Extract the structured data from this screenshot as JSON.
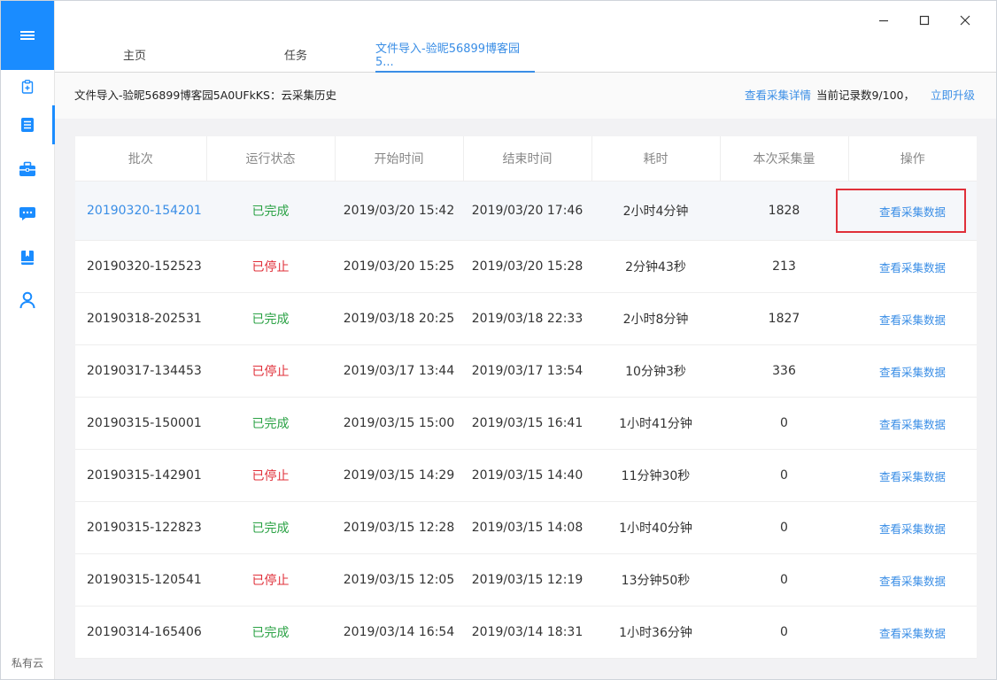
{
  "window": {
    "minimize_label": "—",
    "maximize_label": "□",
    "close_label": "×"
  },
  "sidebar": {
    "footer": "私有云",
    "items": [
      {
        "icon": "clipboard-icon"
      },
      {
        "icon": "document-icon"
      },
      {
        "icon": "briefcase-icon"
      },
      {
        "icon": "chat-icon"
      },
      {
        "icon": "bookmark-icon"
      },
      {
        "icon": "user-icon"
      }
    ]
  },
  "tabs": [
    {
      "label": "主页"
    },
    {
      "label": "任务"
    },
    {
      "label": "文件导入-验昵56899博客园5..."
    }
  ],
  "subheader": {
    "title": "文件导入-验昵56899博客园5A0UFkKS：云采集历史",
    "details_link": "查看采集详情",
    "record_count": "当前记录数9/100，",
    "upgrade_link": "立即升级"
  },
  "table": {
    "headers": [
      "批次",
      "运行状态",
      "开始时间",
      "结束时间",
      "耗时",
      "本次采集量",
      "操作"
    ],
    "rows": [
      {
        "batch": "20190320-154201",
        "status": "已完成",
        "status_type": "done",
        "start": "2019/03/20 15:42",
        "end": "2019/03/20 17:46",
        "duration": "2小时4分钟",
        "amount": "1828",
        "action": "查看采集数据"
      },
      {
        "batch": "20190320-152523",
        "status": "已停止",
        "status_type": "stop",
        "start": "2019/03/20 15:25",
        "end": "2019/03/20 15:28",
        "duration": "2分钟43秒",
        "amount": "213",
        "action": "查看采集数据"
      },
      {
        "batch": "20190318-202531",
        "status": "已完成",
        "status_type": "done",
        "start": "2019/03/18 20:25",
        "end": "2019/03/18 22:33",
        "duration": "2小时8分钟",
        "amount": "1827",
        "action": "查看采集数据"
      },
      {
        "batch": "20190317-134453",
        "status": "已停止",
        "status_type": "stop",
        "start": "2019/03/17 13:44",
        "end": "2019/03/17 13:54",
        "duration": "10分钟3秒",
        "amount": "336",
        "action": "查看采集数据"
      },
      {
        "batch": "20190315-150001",
        "status": "已完成",
        "status_type": "done",
        "start": "2019/03/15 15:00",
        "end": "2019/03/15 16:41",
        "duration": "1小时41分钟",
        "amount": "0",
        "action": "查看采集数据"
      },
      {
        "batch": "20190315-142901",
        "status": "已停止",
        "status_type": "stop",
        "start": "2019/03/15 14:29",
        "end": "2019/03/15 14:40",
        "duration": "11分钟30秒",
        "amount": "0",
        "action": "查看采集数据"
      },
      {
        "batch": "20190315-122823",
        "status": "已完成",
        "status_type": "done",
        "start": "2019/03/15 12:28",
        "end": "2019/03/15 14:08",
        "duration": "1小时40分钟",
        "amount": "0",
        "action": "查看采集数据"
      },
      {
        "batch": "20190315-120541",
        "status": "已停止",
        "status_type": "stop",
        "start": "2019/03/15 12:05",
        "end": "2019/03/15 12:19",
        "duration": "13分钟50秒",
        "amount": "0",
        "action": "查看采集数据"
      },
      {
        "batch": "20190314-165406",
        "status": "已完成",
        "status_type": "done",
        "start": "2019/03/14 16:54",
        "end": "2019/03/14 18:31",
        "duration": "1小时36分钟",
        "amount": "0",
        "action": "查看采集数据"
      }
    ]
  },
  "colors": {
    "accent": "#1a8cff",
    "link": "#3a8ee6",
    "done": "#2ba245",
    "stop": "#e0303a"
  }
}
